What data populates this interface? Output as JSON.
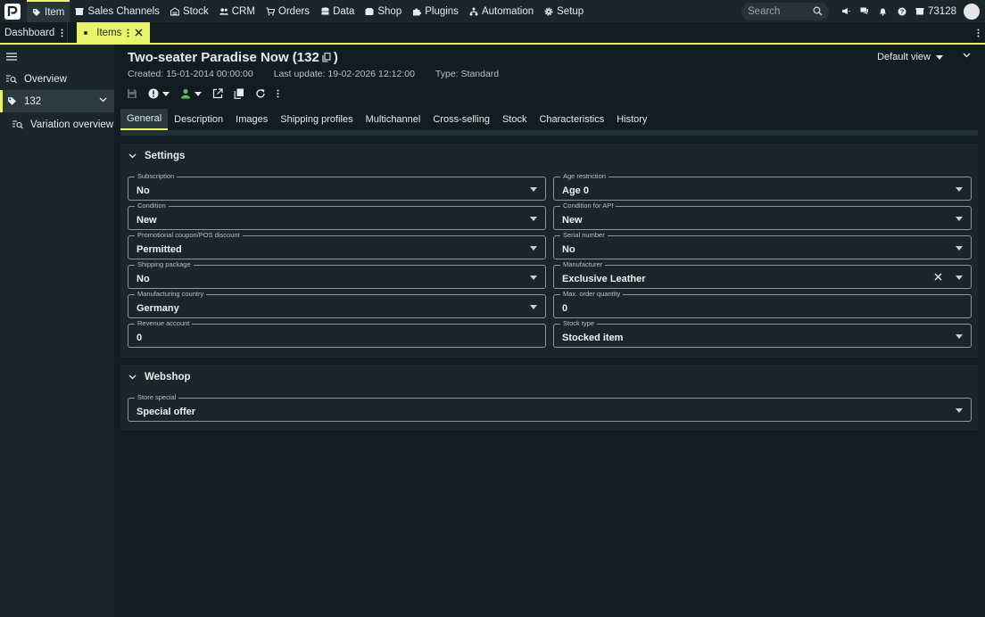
{
  "nav": {
    "items": [
      {
        "label": "Item",
        "icon": "tag-icon"
      },
      {
        "label": "Sales Channels",
        "icon": "storefront-icon"
      },
      {
        "label": "Stock",
        "icon": "warehouse-icon"
      },
      {
        "label": "CRM",
        "icon": "people-icon"
      },
      {
        "label": "Orders",
        "icon": "cart-icon"
      },
      {
        "label": "Data",
        "icon": "database-icon"
      },
      {
        "label": "Shop",
        "icon": "shop-icon"
      },
      {
        "label": "Plugins",
        "icon": "puzzle-icon"
      },
      {
        "label": "Automation",
        "icon": "flow-icon"
      },
      {
        "label": "Setup",
        "icon": "gear-icon"
      }
    ],
    "active": "Item",
    "search_placeholder": "Search",
    "account_id": "73128"
  },
  "tabs_bar": {
    "dashboard": "Dashboard",
    "items": "Items"
  },
  "sidebar": {
    "overview": "Overview",
    "item_id": "132",
    "variation_overview": "Variation overview"
  },
  "header": {
    "title": "Two-seater Paradise Now (132",
    "title_close": ")",
    "created": "Created: 15-01-2014 00:00:00",
    "updated": "Last update: 19-02-2026 12:12:00",
    "type": "Type: Standard",
    "view": "Default view"
  },
  "item_tabs": [
    "General",
    "Description",
    "Images",
    "Shipping profiles",
    "Multichannel",
    "Cross-selling",
    "Stock",
    "Characteristics",
    "History"
  ],
  "active_tab": "General",
  "settings": {
    "title": "Settings",
    "fields": {
      "subscription": {
        "label": "Subscription",
        "value": "No"
      },
      "age_restriction": {
        "label": "Age restriction",
        "value": "Age 0"
      },
      "condition": {
        "label": "Condition",
        "value": "New"
      },
      "condition_api": {
        "label": "Condition for API",
        "value": "New"
      },
      "coupon": {
        "label": "Promotional coupon/POS discount",
        "value": "Permitted"
      },
      "serial_number": {
        "label": "Serial number",
        "value": "No"
      },
      "shipping_package": {
        "label": "Shipping package",
        "value": "No"
      },
      "manufacturer": {
        "label": "Manufacturer",
        "value": "Exclusive Leather"
      },
      "manufacturing_country": {
        "label": "Manufacturing country",
        "value": "Germany"
      },
      "max_order_qty": {
        "label": "Max. order quantity",
        "value": "0"
      },
      "revenue_account": {
        "label": "Revenue account",
        "value": "0"
      },
      "stock_type": {
        "label": "Stock type",
        "value": "Stocked item"
      }
    }
  },
  "webshop": {
    "title": "Webshop",
    "store_special": {
      "label": "Store special",
      "value": "Special offer"
    }
  },
  "colors": {
    "accent": "#e8f56b",
    "background": "#111d23",
    "panel": "#1b262c",
    "success": "#5cb85c"
  }
}
